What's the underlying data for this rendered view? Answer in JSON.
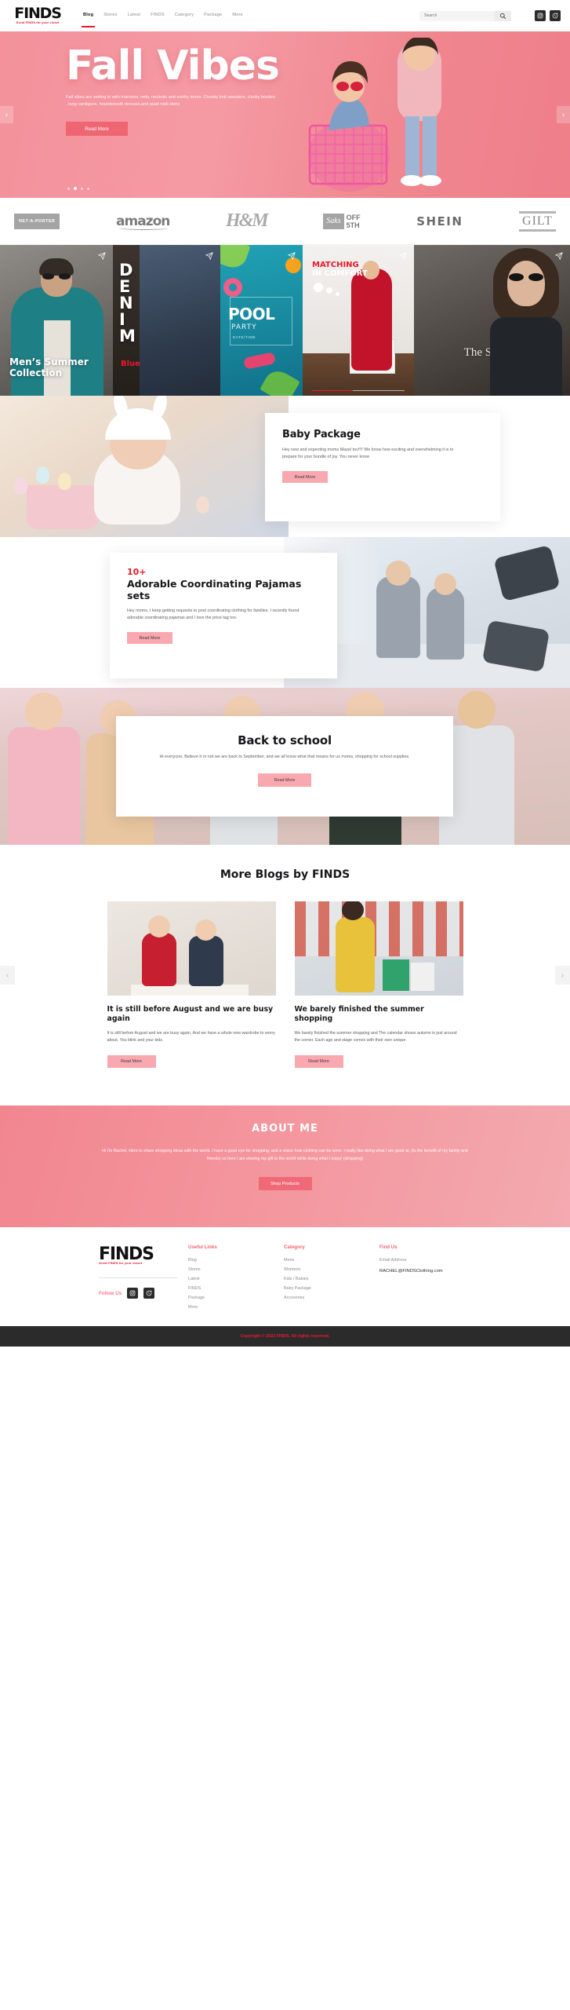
{
  "header": {
    "logo": {
      "name": "FINDS",
      "tagline": "Great FINDS for your closet"
    },
    "nav": [
      {
        "label": "Blog",
        "active": true
      },
      {
        "label": "Stores",
        "active": false
      },
      {
        "label": "Latest",
        "active": false
      },
      {
        "label": "FINDS",
        "active": false
      },
      {
        "label": "Category",
        "active": false
      },
      {
        "label": "Package",
        "active": false
      },
      {
        "label": "More",
        "active": false
      }
    ],
    "search": {
      "placeholder": "Search",
      "value": "",
      "icon": "search-icon"
    },
    "socials": [
      {
        "name": "instagram-icon"
      },
      {
        "name": "whatsapp-icon"
      }
    ]
  },
  "hero": {
    "title": "Fall Vibes",
    "subtitle": "Fall vibes are setting in with maroons, reds, neutrals and earthy tones.  Chunky knit sweaters, clunky booties , long cardigans, houndstooth dresses,and plaid midi skirts",
    "cta": "Read More",
    "prev": "‹",
    "next": "›",
    "dots": 4,
    "active_dot": 2
  },
  "brands": [
    {
      "name": "NET-A-PORTER"
    },
    {
      "name": "amazon"
    },
    {
      "name": "H&M"
    },
    {
      "name": "Saks OFF 5TH",
      "part1": "Saks",
      "part2": "OFF",
      "part3": "5TH"
    },
    {
      "name": "SHEIN"
    },
    {
      "name": "GILT"
    }
  ],
  "tiles": [
    {
      "caption": "Men’s Summer Collection"
    },
    {
      "caption": "DENIM",
      "sub": "Blue"
    },
    {
      "caption": "POOL",
      "sub": "PARTY",
      "meta": "DATE/TIME"
    },
    {
      "caption": "MATCHING",
      "sub": "IN COMFORT"
    },
    {
      "caption": "The Sunday Fashion"
    }
  ],
  "baby": {
    "title": "Baby Package",
    "body": "Hey new and expecting moms Mazel tov!!!! We know how exciting and overwhelming it is to prepare for your bundle of joy. You never know",
    "cta": "Read More"
  },
  "pajamas": {
    "badge": "10+",
    "title": "Adorable Coordinating Pajamas sets",
    "body": "Hey moms, I keep getting requests to post coordinating clothing for families. I recently found adorable coordinating pajamas and I love the price tag too.",
    "cta": "Read More"
  },
  "back_to_school": {
    "title": "Back to school",
    "body": "Hi everyone, Believe it or not we are back to September, and we all know what that means for us moms, shopping for school supplies.",
    "cta": "Read More"
  },
  "more_blogs": {
    "title": "More Blogs by FINDS",
    "prev": "‹",
    "next": "›",
    "cards": [
      {
        "title": "It is still before August and we are busy again",
        "body": "It is still before August and we are busy again, And we have a whole new wardrobe to worry about, You blink and your kids",
        "cta": "Read More"
      },
      {
        "title": "We barely finished the summer shopping",
        "body": "We barely finished the summer shopping and  The calendar shows autumn is just around the corner. Each age and stage comes with their own unique",
        "cta": "Read More"
      }
    ]
  },
  "about": {
    "title": "ABOUT ME",
    "body": "Hi i'm Rachel, Here to share shopping ideas with the world. I have a good eye for shopping, and a vision how clothing can be worn. I really like doing what I am good at, (to the benefit of my family and friends) so here I am sharing my gift to the world while doing what I enjoy! (shopping)",
    "cta": "Shop Products"
  },
  "footer": {
    "logo": {
      "name": "FINDS",
      "tagline": "Great FINDS for your closet"
    },
    "follow_label": "Follow Us",
    "socials": [
      {
        "name": "instagram-icon"
      },
      {
        "name": "whatsapp-icon"
      }
    ],
    "columns": [
      {
        "heading": "Useful Links",
        "links": [
          "Blog",
          "Stores",
          "Latest",
          "FINDS",
          "Package",
          "More"
        ]
      },
      {
        "heading": "Category",
        "links": [
          "Mens",
          "Womens",
          "Kids / Babies",
          "Baby Package",
          "Accesories"
        ]
      }
    ],
    "find_us": {
      "heading": "Find Us",
      "label": "Email Address",
      "email": "RACHEL@FINDSClothing.com"
    },
    "copyright": "Copyright © 2022 FINDS. All rights reserved."
  },
  "colors": {
    "accent_pink": "#f8a8ae",
    "hero_pink": "#f4919b",
    "red": "#e8192c",
    "cta_red": "#ef6572"
  }
}
